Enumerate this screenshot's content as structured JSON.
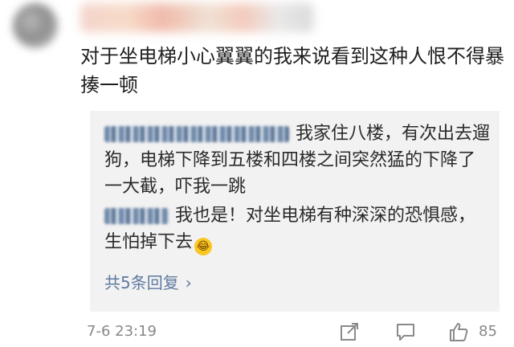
{
  "comment": {
    "text": "对于坐电梯小心翼翼的我来说看到这种人恨不得暴揍一顿"
  },
  "replies": [
    {
      "text": "我家住八楼，有次出去遛狗，电梯下降到五楼和四楼之间突然猛的下降了一大截，吓我一跳"
    },
    {
      "text": "我也是！对坐电梯有种深深的恐惧感，生怕掉下去",
      "emoji": "crying-laughing-emoji"
    }
  ],
  "more_replies": {
    "label": "共5条回复",
    "chevron": "›"
  },
  "footer": {
    "timestamp": "7-6 23:19",
    "like_count": "85"
  },
  "colors": {
    "link": "#5e7aa0",
    "reply_bg": "#f2f2f2",
    "meta_text": "#888888"
  }
}
